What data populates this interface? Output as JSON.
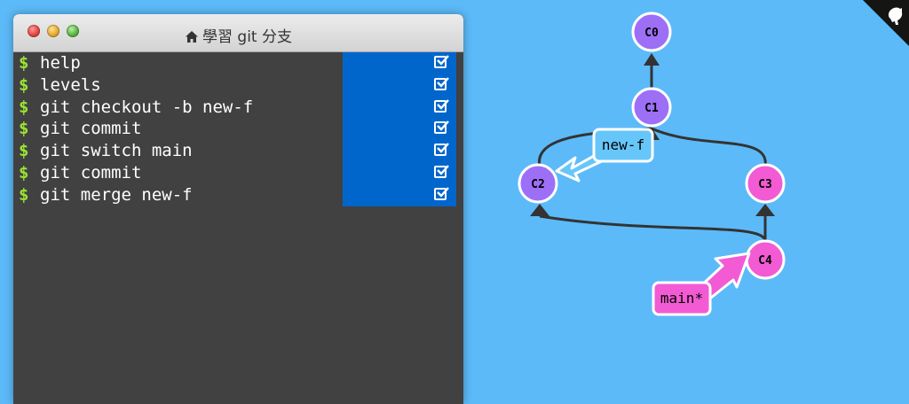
{
  "window": {
    "title": "學習 git 分支",
    "icon": "home-icon"
  },
  "commands": [
    {
      "prompt": "$",
      "text": "help",
      "status": "done"
    },
    {
      "prompt": "$",
      "text": "levels",
      "status": "done"
    },
    {
      "prompt": "$",
      "text": "git checkout -b new-f",
      "status": "done"
    },
    {
      "prompt": "$",
      "text": "git commit",
      "status": "done"
    },
    {
      "prompt": "$",
      "text": "git switch main",
      "status": "done"
    },
    {
      "prompt": "$",
      "text": "git commit",
      "status": "done"
    },
    {
      "prompt": "$",
      "text": "git merge new-f",
      "status": "done"
    }
  ],
  "graph": {
    "commits": [
      {
        "id": "C0",
        "branch_color": "#9d6ff7"
      },
      {
        "id": "C1",
        "branch_color": "#9d6ff7"
      },
      {
        "id": "C2",
        "branch_color": "#9d6ff7"
      },
      {
        "id": "C3",
        "branch_color": "#f25bd4"
      },
      {
        "id": "C4",
        "branch_color": "#f25bd4"
      }
    ],
    "edges": [
      {
        "from": "C1",
        "to": "C0"
      },
      {
        "from": "C2",
        "to": "C1"
      },
      {
        "from": "C3",
        "to": "C1"
      },
      {
        "from": "C4",
        "to": "C2"
      },
      {
        "from": "C4",
        "to": "C3"
      }
    ],
    "branches": [
      {
        "name": "new-f",
        "target": "C2",
        "color": "#67c6f9",
        "current": false
      },
      {
        "name": "main*",
        "target": "C4",
        "color": "#f25bd4",
        "current": true
      }
    ]
  },
  "colors": {
    "background": "#5cbaf8",
    "terminal": "#414141",
    "prompt": "#9ae331",
    "done_highlight": "#0066cc"
  },
  "corner_icon": "octocat-icon"
}
